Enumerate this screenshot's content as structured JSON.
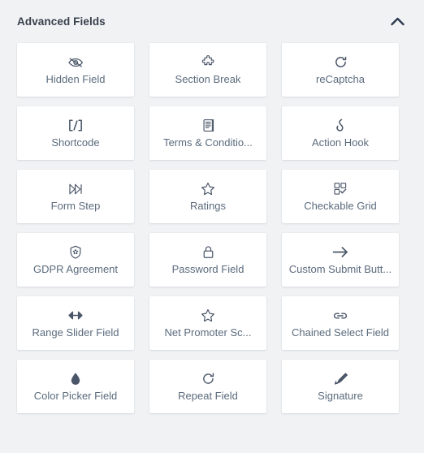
{
  "panel": {
    "title": "Advanced Fields",
    "toggle_icon": "chevron-up-icon",
    "toggle_state": "expanded",
    "accent_color": "#37404c",
    "card_background": "#ffffff",
    "panel_background": "#f1f2f4",
    "label_color": "#5b6b7d",
    "icon_color": "#4a5668"
  },
  "fields": [
    {
      "label": "Hidden Field",
      "icon": "eye-slash-icon",
      "name": "hidden-field"
    },
    {
      "label": "Section Break",
      "icon": "puzzle-piece-icon",
      "name": "section-break"
    },
    {
      "label": "reCaptcha",
      "icon": "refresh-arc-icon",
      "name": "recaptcha"
    },
    {
      "label": "Shortcode",
      "icon": "bracket-slash-icon",
      "name": "shortcode"
    },
    {
      "label": "Terms & Conditio...",
      "icon": "scroll-document-icon",
      "name": "terms-and-conditions"
    },
    {
      "label": "Action Hook",
      "icon": "hook-icon",
      "name": "action-hook"
    },
    {
      "label": "Form Step",
      "icon": "skip-forward-icon",
      "name": "form-step"
    },
    {
      "label": "Ratings",
      "icon": "star-outline-icon",
      "name": "ratings"
    },
    {
      "label": "Checkable Grid",
      "icon": "grid-check-icon",
      "name": "checkable-grid"
    },
    {
      "label": "GDPR Agreement",
      "icon": "shield-star-icon",
      "name": "gdpr-agreement"
    },
    {
      "label": "Password Field",
      "icon": "lock-icon",
      "name": "password-field"
    },
    {
      "label": "Custom Submit Butt...",
      "icon": "arrow-right-icon",
      "name": "custom-submit-button"
    },
    {
      "label": "Range Slider Field",
      "icon": "left-right-arrow-icon",
      "name": "range-slider-field"
    },
    {
      "label": "Net Promoter Sc...",
      "icon": "star-outline-icon",
      "name": "net-promoter-score"
    },
    {
      "label": "Chained Select Field",
      "icon": "chain-link-icon",
      "name": "chained-select-field"
    },
    {
      "label": "Color Picker Field",
      "icon": "droplet-icon",
      "name": "color-picker-field"
    },
    {
      "label": "Repeat Field",
      "icon": "circular-arrow-icon",
      "name": "repeat-field"
    },
    {
      "label": "Signature",
      "icon": "pen-nib-icon",
      "name": "signature"
    }
  ]
}
